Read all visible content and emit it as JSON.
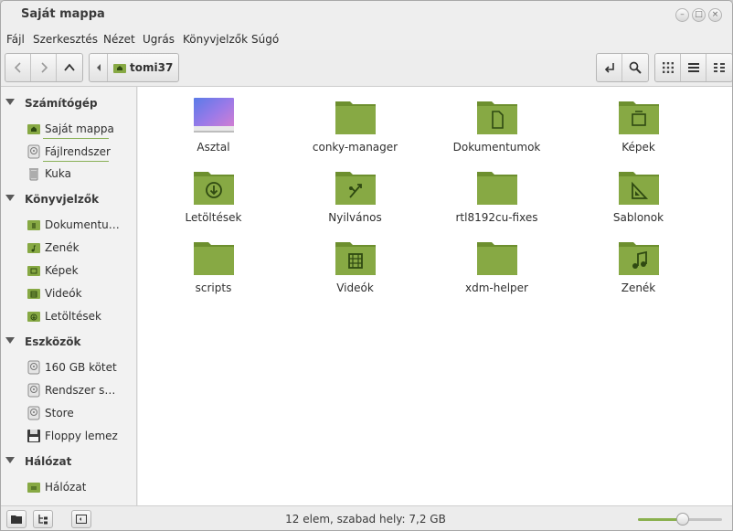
{
  "window": {
    "title": "Saját mappa"
  },
  "menubar": {
    "items": [
      "Fájl",
      "Szerkesztés",
      "Nézet",
      "Ugrás",
      "Könyvjelzők",
      "Súgó"
    ]
  },
  "breadcrumb": {
    "current": "tomi37"
  },
  "sidebar": {
    "sections": [
      {
        "label": "Számítógép",
        "items": [
          {
            "label": "Saját mappa",
            "icon": "home-folder-icon"
          },
          {
            "label": "Fájlrendszer",
            "icon": "drive-icon"
          },
          {
            "label": "Kuka",
            "icon": "trash-icon"
          }
        ]
      },
      {
        "label": "Könyvjelzők",
        "items": [
          {
            "label": "Dokumentu…",
            "icon": "documents-folder-icon"
          },
          {
            "label": "Zenék",
            "icon": "music-folder-icon"
          },
          {
            "label": "Képek",
            "icon": "pictures-folder-icon"
          },
          {
            "label": "Videók",
            "icon": "videos-folder-icon"
          },
          {
            "label": "Letöltések",
            "icon": "downloads-folder-icon"
          }
        ]
      },
      {
        "label": "Eszközök",
        "items": [
          {
            "label": "160 GB kötet",
            "icon": "drive-icon"
          },
          {
            "label": "Rendszer s…",
            "icon": "drive-icon"
          },
          {
            "label": "Store",
            "icon": "drive-icon"
          },
          {
            "label": "Floppy lemez",
            "icon": "floppy-icon"
          }
        ]
      },
      {
        "label": "Hálózat",
        "items": [
          {
            "label": "Hálózat",
            "icon": "network-folder-icon"
          }
        ]
      }
    ]
  },
  "files": [
    {
      "name": "Asztal",
      "icon": "desktop-icon"
    },
    {
      "name": "conky-manager",
      "icon": "folder-icon"
    },
    {
      "name": "Dokumentumok",
      "icon": "documents-folder-icon"
    },
    {
      "name": "Képek",
      "icon": "pictures-folder-icon"
    },
    {
      "name": "Letöltések",
      "icon": "downloads-folder-icon"
    },
    {
      "name": "Nyilvános",
      "icon": "public-folder-icon"
    },
    {
      "name": "rtl8192cu-fixes",
      "icon": "folder-icon"
    },
    {
      "name": "Sablonok",
      "icon": "templates-folder-icon"
    },
    {
      "name": "scripts",
      "icon": "folder-icon"
    },
    {
      "name": "Videók",
      "icon": "videos-folder-icon"
    },
    {
      "name": "xdm-helper",
      "icon": "folder-icon"
    },
    {
      "name": "Zenék",
      "icon": "music-folder-icon"
    }
  ],
  "statusbar": {
    "text": "12 elem, szabad hely: 7,2 GB",
    "zoom_level": 0.53
  },
  "colors": {
    "folder_green": "#87a944",
    "folder_dark": "#6d8f2e",
    "accent": "#8ab04e"
  }
}
